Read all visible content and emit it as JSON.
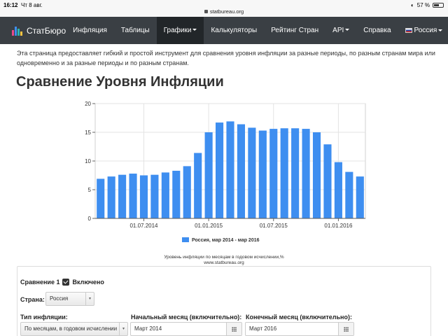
{
  "statusbar": {
    "time": "16:12",
    "date": "Чт 8 авг.",
    "url": "statbureau.org",
    "battery": "57 %",
    "battery_level": 0.57
  },
  "navbar": {
    "brand": "СтатБюро",
    "items": [
      "Инфляция",
      "Таблицы",
      "Графики",
      "Калькуляторы",
      "Рейтинг Стран",
      "API",
      "Справка"
    ],
    "language": "Россия"
  },
  "intro": "Эта страница предоставляет гибкий и простой инструмент для сравнения уровня инфляции за разные периоды, по разным странам мира или одновременно и за разные периоды и по разным странам.",
  "page_title": "Сравнение Уровня Инфляции",
  "colors": {
    "bar": "#3e8ef0",
    "navbar": "#3a3f44",
    "navbar_active": "#222629"
  },
  "chart_data": {
    "type": "bar",
    "series": [
      {
        "name": "Россия, мар 2014 - мар 2016",
        "values": [
          6.9,
          7.3,
          7.6,
          7.8,
          7.5,
          7.6,
          8.0,
          8.3,
          9.1,
          11.4,
          15.0,
          16.7,
          16.9,
          16.4,
          15.8,
          15.3,
          15.6,
          15.7,
          15.7,
          15.6,
          15.0,
          12.9,
          9.8,
          8.1,
          7.3
        ]
      }
    ],
    "x_tick_labels": [
      {
        "label": "01.07.2014",
        "index": 4
      },
      {
        "label": "01.01.2015",
        "index": 10
      },
      {
        "label": "01.07.2015",
        "index": 16
      },
      {
        "label": "01.01.2016",
        "index": 22
      }
    ],
    "yticks": [
      0,
      5,
      10,
      15,
      20
    ],
    "ylim": [
      0,
      20
    ],
    "grid": true,
    "legend_placement": "bottom",
    "caption": "Уровень инфляции по месяцам в годовом исчислении,%",
    "source": "www.statbureau.org"
  },
  "comparison": {
    "label": "Сравнение 1",
    "enabled_label": "Включено",
    "country_label": "Страна:",
    "country_value": "Россия",
    "inflation_type_label": "Тип инфляции:",
    "inflation_type_value": "По месяцам, в годовом исчислении",
    "start_label": "Начальный месяц (включительно):",
    "start_value": "Март 2014",
    "end_label": "Конечный месяц (включительно):",
    "end_value": "Март 2016"
  }
}
